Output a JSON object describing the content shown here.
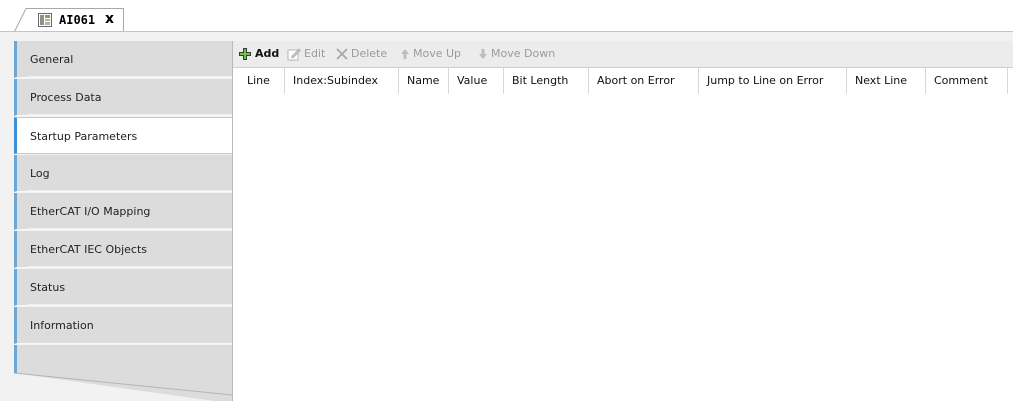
{
  "tab": {
    "title": "AI061",
    "close": "x",
    "icon": "device-config-icon"
  },
  "sidebar": {
    "items": [
      {
        "label": "General",
        "active": false
      },
      {
        "label": "Process Data",
        "active": false
      },
      {
        "label": "Startup Parameters",
        "active": true
      },
      {
        "label": "Log",
        "active": false
      },
      {
        "label": "EtherCAT I/O Mapping",
        "active": false
      },
      {
        "label": "EtherCAT IEC Objects",
        "active": false
      },
      {
        "label": "Status",
        "active": false
      },
      {
        "label": "Information",
        "active": false
      }
    ]
  },
  "toolbar": {
    "add": "Add",
    "edit": "Edit",
    "delete": "Delete",
    "move_up": "Move Up",
    "move_down": "Move Down"
  },
  "table": {
    "columns": [
      "Line",
      "Index:Subindex",
      "Name",
      "Value",
      "Bit Length",
      "Abort on Error",
      "Jump to Line on Error",
      "Next Line",
      "Comment"
    ],
    "rows": []
  },
  "colors": {
    "accent": "#3d8fd6",
    "inactive_tab": "#dcdcdc",
    "toolbar": "#ececec"
  }
}
